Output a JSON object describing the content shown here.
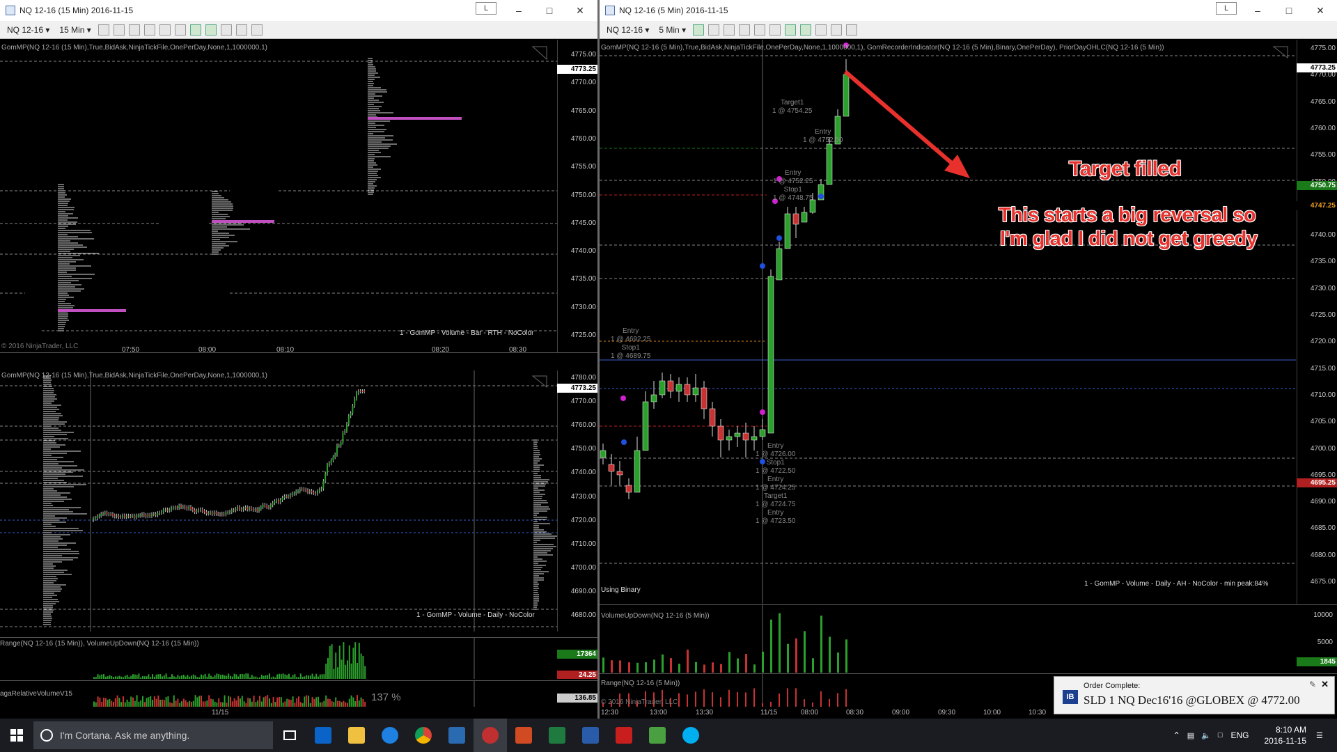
{
  "left_window": {
    "title": "NQ 12-16 (15 Min)  2016-11-15",
    "lock_label": "L",
    "toolbar": {
      "instrument": "NQ 12-16",
      "period": "15 Min"
    },
    "top_chart": {
      "indicator": "GomMP(NQ 12-16 (15 Min),True,BidAsk,NinjaTickFile,OnePerDay,None,1,1000000,1)",
      "label": "1 - GomMP  - Volume - Bar - RTH - NoColor",
      "copyright": "© 2016 NinjaTrader, LLC",
      "current_price": "4773.25",
      "y_ticks": [
        "4775.00",
        "4770.00",
        "4765.00",
        "4760.00",
        "4755.00",
        "4750.00",
        "4745.00",
        "4740.00",
        "4735.00",
        "4730.00",
        "4725.00"
      ],
      "x_ticks": [
        "07:50",
        "08:00",
        "08:10",
        "08:20",
        "08:30"
      ]
    },
    "bottom_chart": {
      "indicator": "GomMP(NQ 12-16 (15 Min),True,BidAsk,NinjaTickFile,OnePerDay,None,1,1000000,1)",
      "label": "1 - GomMP  - Volume - Daily - NoColor",
      "current_price": "4773.25",
      "y_ticks": [
        "4780.00",
        "4770.00",
        "4760.00",
        "4750.00",
        "4740.00",
        "4730.00",
        "4720.00",
        "4710.00",
        "4700.00",
        "4690.00",
        "4680.00"
      ]
    },
    "range_panel": {
      "indicator": "Range(NQ 12-16 (15 Min)), VolumeUpDown(NQ 12-16 (15 Min))",
      "tag_green": "17364",
      "tag_red": "24.25"
    },
    "rel_panel": {
      "indicator": "agaRelativeVolumeV15",
      "pct": "137 %",
      "tag": "136.85"
    },
    "x_label": "11/15"
  },
  "right_window": {
    "title": "NQ 12-16 (5 Min)  2016-11-15",
    "lock_label": "L",
    "toolbar": {
      "instrument": "NQ 12-16",
      "period": "5 Min"
    },
    "main_chart": {
      "indicator": "GomMP(NQ 12-16 (5 Min),True,BidAsk,NinjaTickFile,OnePerDay,None,1,1000000,1), GomRecorderIndicator(NQ 12-16 (5 Min),Binary,OnePerDay), PriorDayOHLC(NQ 12-16 (5 Min))",
      "using": "Using Binary",
      "label": "1 - GomMP  - Volume - Daily - AH - NoColor - min peak:84%",
      "current_price": "4773.25",
      "tag_green": "4750.75",
      "tag_orange": "4747.25",
      "tag_red": "4695.25",
      "y_ticks": [
        "4775.00",
        "4770.00",
        "4765.00",
        "4760.00",
        "4755.00",
        "4750.00",
        "4745.00",
        "4740.00",
        "4735.00",
        "4730.00",
        "4725.00",
        "4720.00",
        "4715.00",
        "4710.00",
        "4705.00",
        "4700.00",
        "4695.00",
        "4690.00",
        "4685.00",
        "4680.00",
        "4675.00"
      ],
      "trade_labels": [
        {
          "text": "Entry\n1 @ 4692.25\nStop1\n1 @ 4689.75"
        },
        {
          "text": "Target1\n1 @ 4754.25"
        },
        {
          "text": "Entry\n1 @ 4752.50"
        },
        {
          "text": "Entry\n1 @ 4752.25\nStop1\n1 @ 4748.75"
        },
        {
          "text": "Entry\n1 @ 4726.00\nStop1\n1 @ 4722.50\nEntry\n1 @ 4724.25\nTarget1\n1 @ 4724.75\nEntry\n1 @ 4723.50"
        }
      ]
    },
    "vol_panel": {
      "indicator": "VolumeUpDown(NQ 12-16 (5 Min))",
      "y_ticks": [
        "10000",
        "5000"
      ],
      "tag": "1845"
    },
    "range_panel": {
      "indicator": "Range(NQ 12-16 (5 Min))",
      "copyright": "© 2016 NinjaTrader, LLC"
    },
    "x_ticks": [
      "12:30",
      "13:00",
      "13:30",
      "11/15",
      "08:00",
      "08:30",
      "09:00",
      "09:30",
      "10:00",
      "10:30"
    ]
  },
  "annotations": {
    "target": "Target filled",
    "reversal_line1": "This starts a big reversal so",
    "reversal_line2": "I'm glad I did not get greedy"
  },
  "toast": {
    "title": "Order Complete:",
    "badge": "IB",
    "message": "SLD 1 NQ Dec16'16 @GLOBEX @ 4772.00"
  },
  "taskbar": {
    "search": "I'm Cortana. Ask me anything.",
    "lang": "ENG",
    "time": "8:10 AM",
    "date": "2016-11-15"
  }
}
